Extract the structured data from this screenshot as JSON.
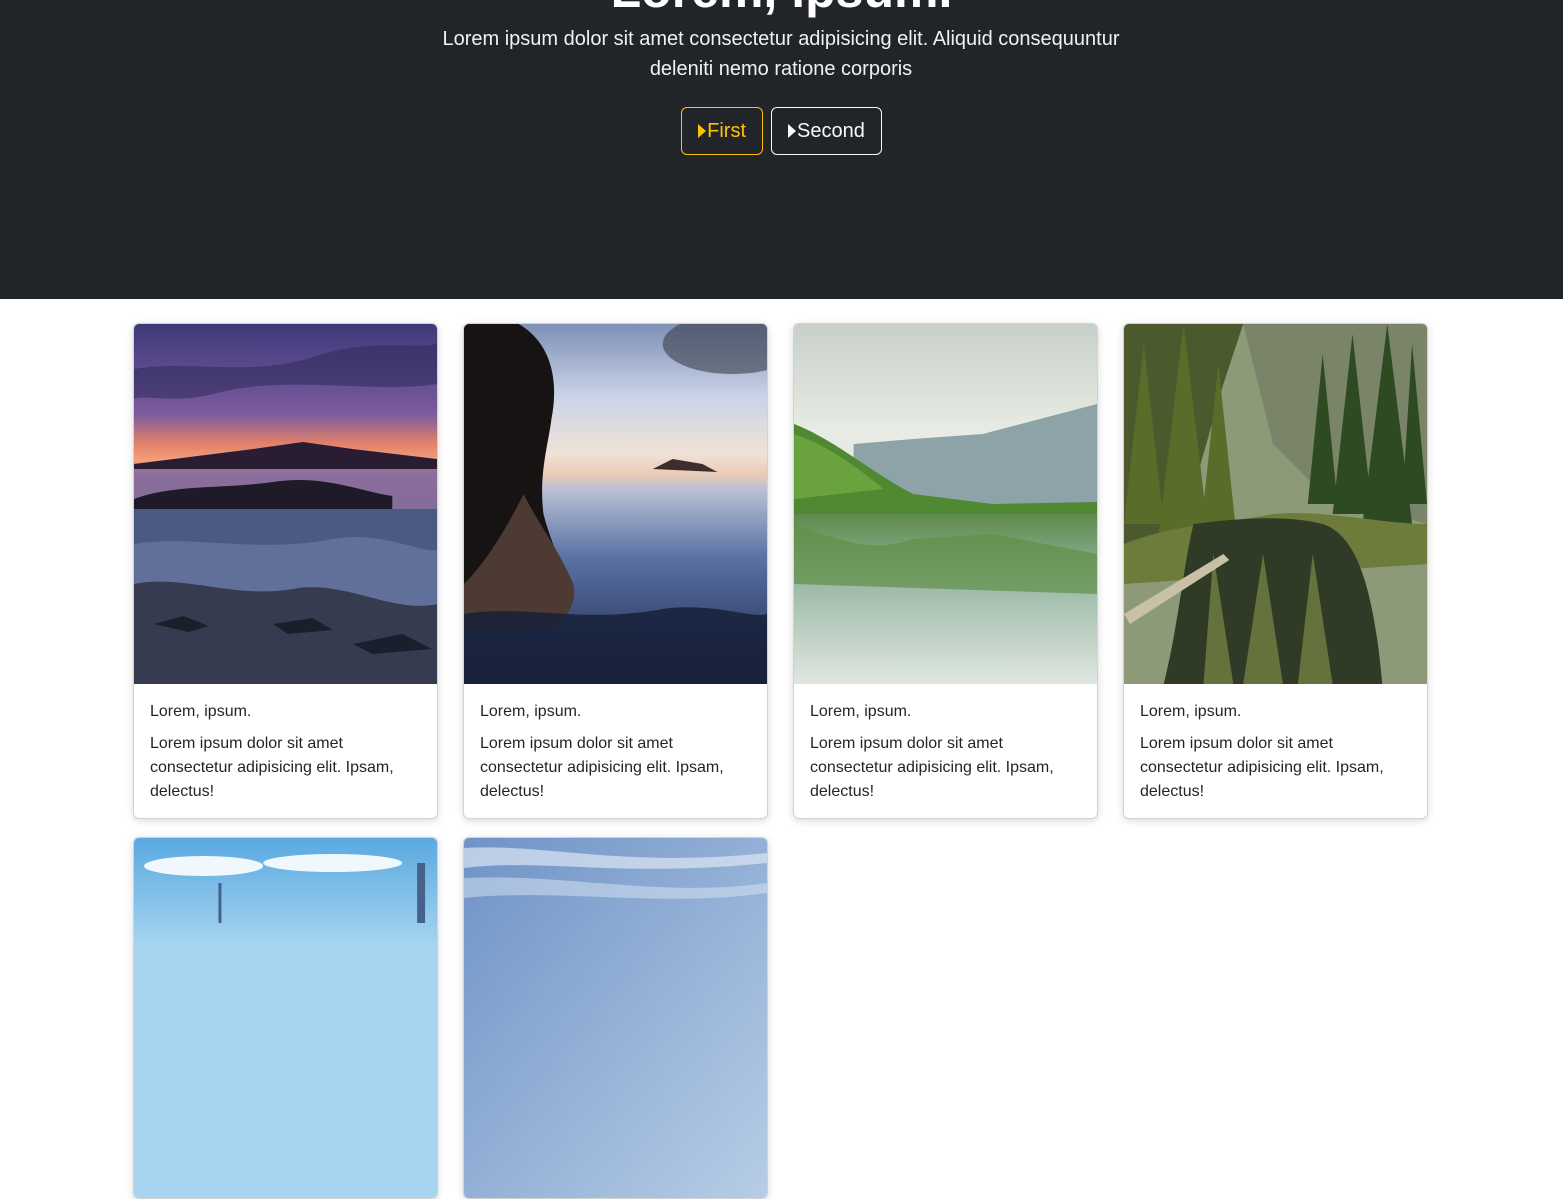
{
  "hero": {
    "title": "Lorem, ipsum.",
    "lead": "Lorem ipsum dolor sit amet consectetur adipisicing elit. Aliquid consequuntur deleniti nemo ratione corporis",
    "buttons": [
      {
        "label": "First",
        "icon": "play-icon",
        "color": "#ffc107"
      },
      {
        "label": "Second",
        "icon": "play-icon",
        "color": "#f8f9fa"
      }
    ]
  },
  "cards": [
    {
      "title": "Lorem, ipsum.",
      "text": "Lorem ipsum dolor sit amet consectetur adipisicing elit. Ipsam, delectus!",
      "image": "purple-sunset-coast-photo"
    },
    {
      "title": "Lorem, ipsum.",
      "text": "Lorem ipsum dolor sit amet consectetur adipisicing elit. Ipsam, delectus!",
      "image": "person-in-water-photo"
    },
    {
      "title": "Lorem, ipsum.",
      "text": "Lorem ipsum dolor sit amet consectetur adipisicing elit. Ipsam, delectus!",
      "image": "mountain-lake-reflection-photo"
    },
    {
      "title": "Lorem, ipsum.",
      "text": "Lorem ipsum dolor sit amet consectetur adipisicing elit. Ipsam, delectus!",
      "image": "forest-river-photo"
    },
    {
      "image": "city-skyline-photo"
    },
    {
      "image": "blue-sky-photo"
    }
  ],
  "colors": {
    "hero_bg": "#212529",
    "accent": "#ffc107",
    "light": "#f8f9fa"
  }
}
